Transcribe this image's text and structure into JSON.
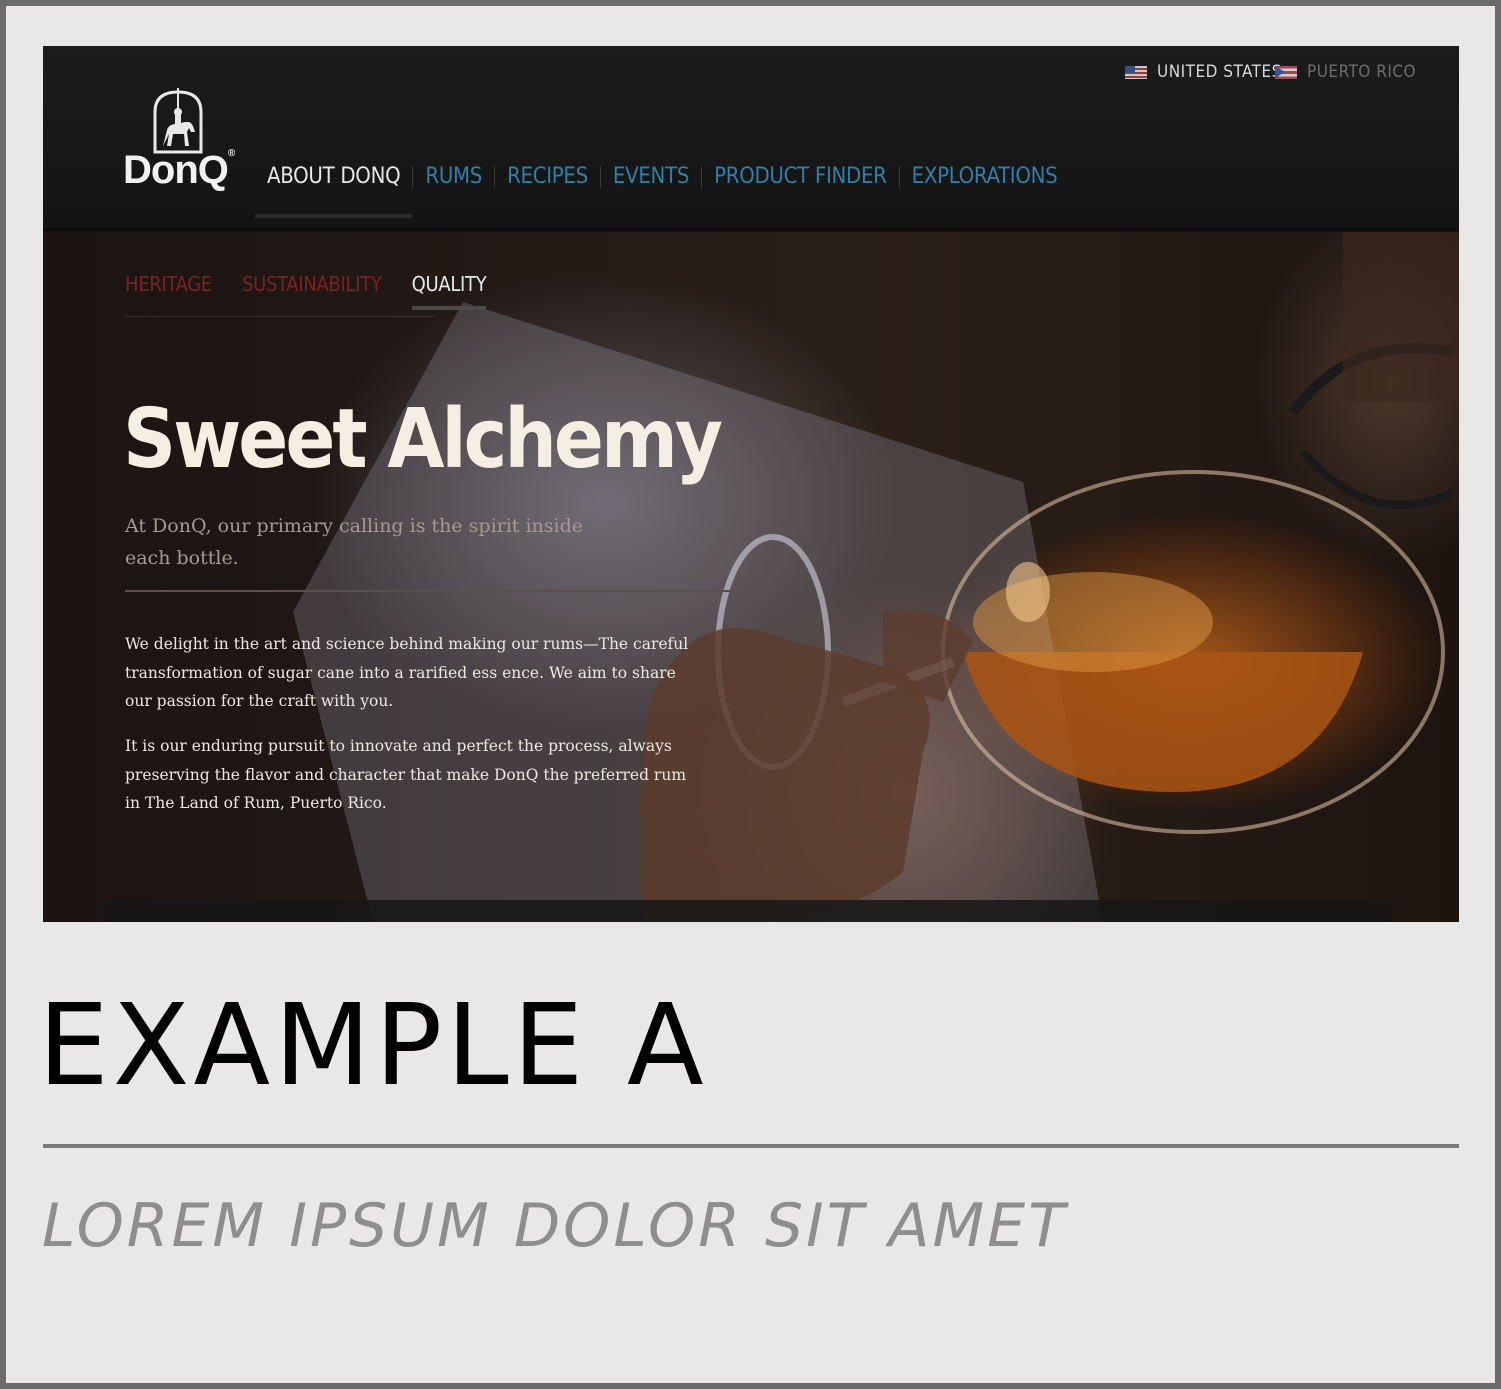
{
  "header": {
    "locales": [
      {
        "label": "UNITED STATES",
        "flag": "us-flag-icon",
        "active": true
      },
      {
        "label": "PUERTO RICO",
        "flag": "puerto-rico-flag-icon",
        "active": false
      }
    ],
    "logo_text": "DonQ",
    "logo_mark": "®",
    "nav": [
      {
        "label": "ABOUT DONQ",
        "active": true
      },
      {
        "label": "RUMS",
        "active": false
      },
      {
        "label": "RECIPES",
        "active": false
      },
      {
        "label": "EVENTS",
        "active": false
      },
      {
        "label": "PRODUCT FINDER",
        "active": false
      },
      {
        "label": "EXPLORATIONS",
        "active": false
      }
    ]
  },
  "hero": {
    "subnav": [
      {
        "label": "HERITAGE",
        "active": false
      },
      {
        "label": "SUSTAINABILITY",
        "active": false
      },
      {
        "label": "QUALITY",
        "active": true
      }
    ],
    "title": "Sweet Alchemy",
    "lead": "At DonQ, our primary calling is the spirit inside each bottle.",
    "body_1": "We delight in the art and science behind making our rums—The careful transformation of sugar cane into a rarified ess ence. We aim to share our passion for the craft with you.",
    "body_2": "It is our enduring pursuit to innovate and perfect the process, always preserving the flavor and character that make DonQ the preferred rum in The Land of Rum, Puerto Rico."
  },
  "caption": {
    "title": "EXAMPLE A",
    "subtitle": "LOREM IPSUM DOLOR SIT AMET"
  },
  "colors": {
    "nav_link": "#2f7fa8",
    "subnav_inactive": "#7a2226",
    "title": "#f4efe2",
    "frame": "#6b6b6b",
    "background": "#e9e8e6"
  }
}
